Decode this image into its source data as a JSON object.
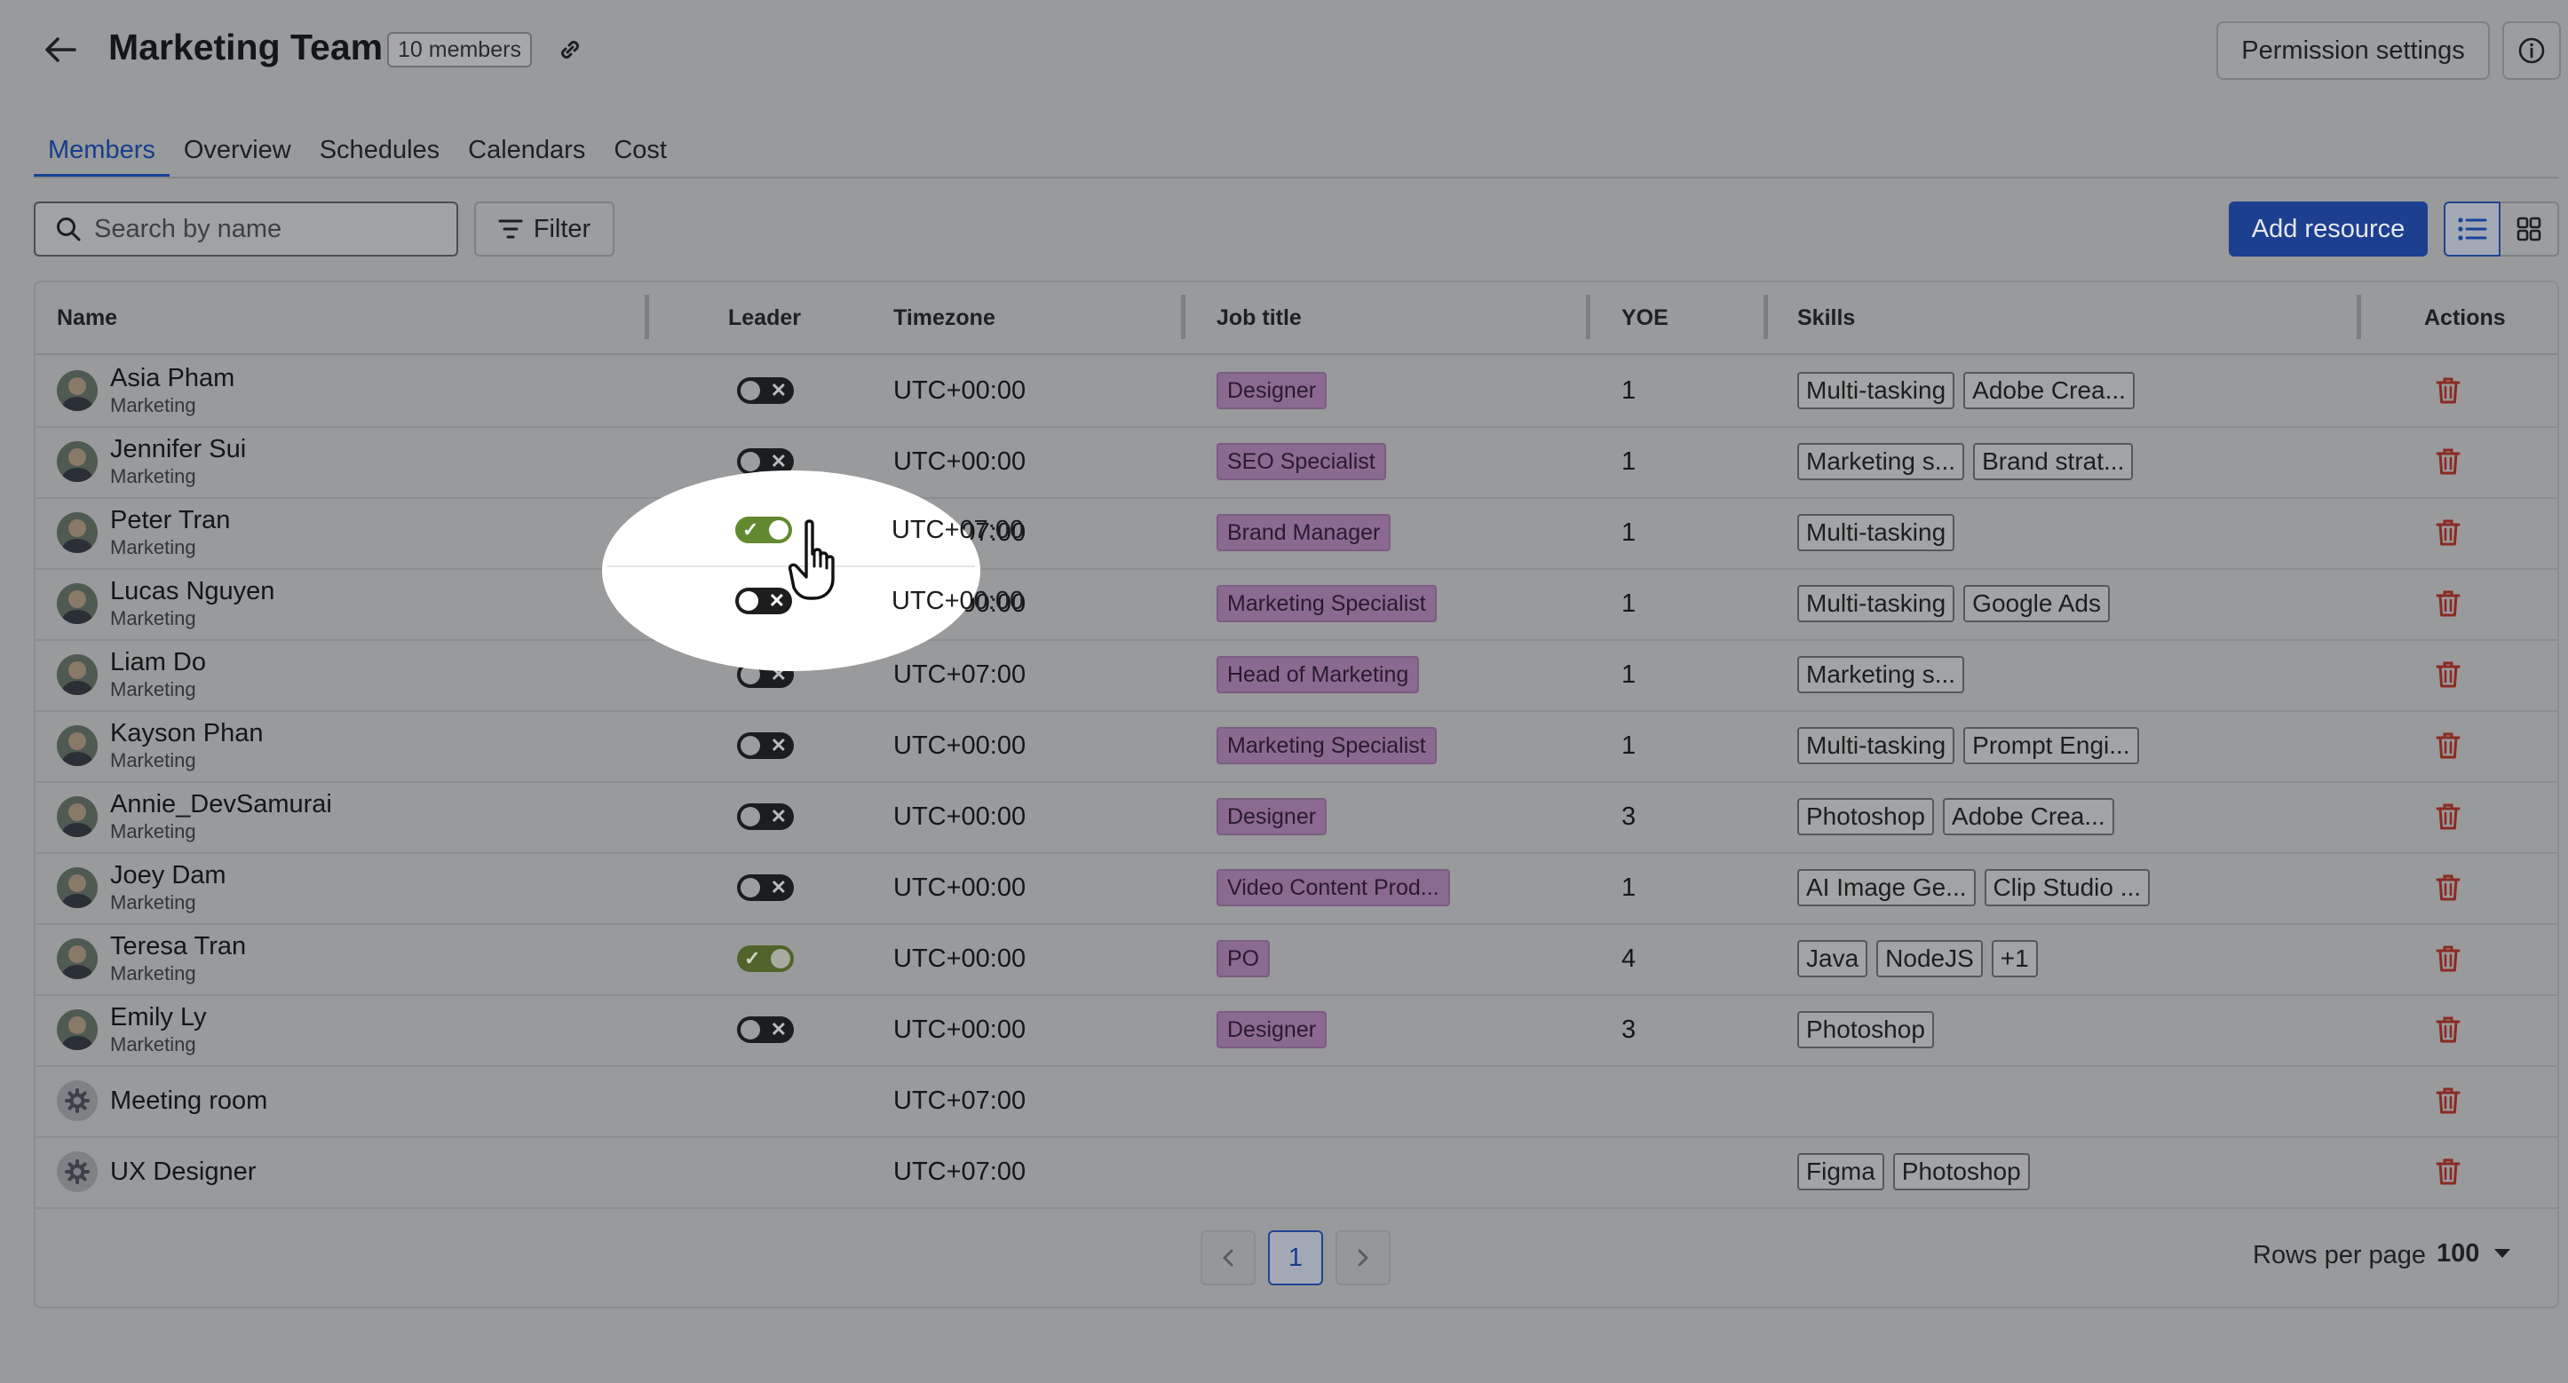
{
  "header": {
    "title": "Marketing Team",
    "member_count": "10 members",
    "permission_label": "Permission settings"
  },
  "tabs": [
    {
      "label": "Members",
      "active": true
    },
    {
      "label": "Overview",
      "active": false
    },
    {
      "label": "Schedules",
      "active": false
    },
    {
      "label": "Calendars",
      "active": false
    },
    {
      "label": "Cost",
      "active": false
    }
  ],
  "toolbar": {
    "search_placeholder": "Search by name",
    "filter_label": "Filter",
    "add_label": "Add resource"
  },
  "table": {
    "columns": {
      "name": "Name",
      "leader": "Leader",
      "timezone": "Timezone",
      "job": "Job title",
      "yoe": "YOE",
      "skills": "Skills",
      "actions": "Actions"
    },
    "rows": [
      {
        "name": "Asia Pham",
        "dept": "Marketing",
        "leader": false,
        "timezone": "UTC+00:00",
        "job": "Designer",
        "yoe": "1",
        "skills": [
          "Multi-tasking",
          "Adobe Crea..."
        ]
      },
      {
        "name": "Jennifer Sui",
        "dept": "Marketing",
        "leader": false,
        "timezone": "UTC+00:00",
        "job": "SEO Specialist",
        "yoe": "1",
        "skills": [
          "Marketing s...",
          "Brand strat..."
        ]
      },
      {
        "name": "Peter Tran",
        "dept": "Marketing",
        "leader": true,
        "timezone": "UTC+07:00",
        "job": "Brand Manager",
        "yoe": "1",
        "skills": [
          "Multi-tasking"
        ]
      },
      {
        "name": "Lucas Nguyen",
        "dept": "Marketing",
        "leader": false,
        "timezone": "UTC+00:00",
        "job": "Marketing Specialist",
        "yoe": "1",
        "skills": [
          "Multi-tasking",
          "Google Ads"
        ]
      },
      {
        "name": "Liam Do",
        "dept": "Marketing",
        "leader": false,
        "timezone": "UTC+07:00",
        "job": "Head of Marketing",
        "yoe": "1",
        "skills": [
          "Marketing s..."
        ]
      },
      {
        "name": "Kayson Phan",
        "dept": "Marketing",
        "leader": false,
        "timezone": "UTC+00:00",
        "job": "Marketing Specialist",
        "yoe": "1",
        "skills": [
          "Multi-tasking",
          "Prompt Engi..."
        ]
      },
      {
        "name": "Annie_DevSamurai",
        "dept": "Marketing",
        "leader": false,
        "timezone": "UTC+00:00",
        "job": "Designer",
        "yoe": "3",
        "skills": [
          "Photoshop",
          "Adobe Crea..."
        ]
      },
      {
        "name": "Joey Dam",
        "dept": "Marketing",
        "leader": false,
        "timezone": "UTC+00:00",
        "job": "Video Content Prod...",
        "yoe": "1",
        "skills": [
          "AI Image Ge...",
          "Clip Studio ..."
        ]
      },
      {
        "name": "Teresa Tran",
        "dept": "Marketing",
        "leader": true,
        "timezone": "UTC+00:00",
        "job": "PO",
        "yoe": "4",
        "skills": [
          "Java",
          "NodeJS",
          "+1"
        ]
      },
      {
        "name": "Emily Ly",
        "dept": "Marketing",
        "leader": false,
        "timezone": "UTC+00:00",
        "job": "Designer",
        "yoe": "3",
        "skills": [
          "Photoshop"
        ]
      },
      {
        "name": "Meeting room",
        "dept": "",
        "leader": null,
        "timezone": "UTC+07:00",
        "job": "",
        "yoe": "",
        "skills": [],
        "resource": true
      },
      {
        "name": "UX Designer",
        "dept": "",
        "leader": null,
        "timezone": "UTC+07:00",
        "job": "",
        "yoe": "",
        "skills": [
          "Figma",
          "Photoshop"
        ],
        "resource": true
      }
    ]
  },
  "pagination": {
    "current_page": "1",
    "rows_per_page_label": "Rows per page",
    "rows_per_page_value": "100"
  },
  "colors": {
    "accent": "#17449a",
    "toggle_on": "#62892f",
    "delete": "#8a2a22"
  }
}
